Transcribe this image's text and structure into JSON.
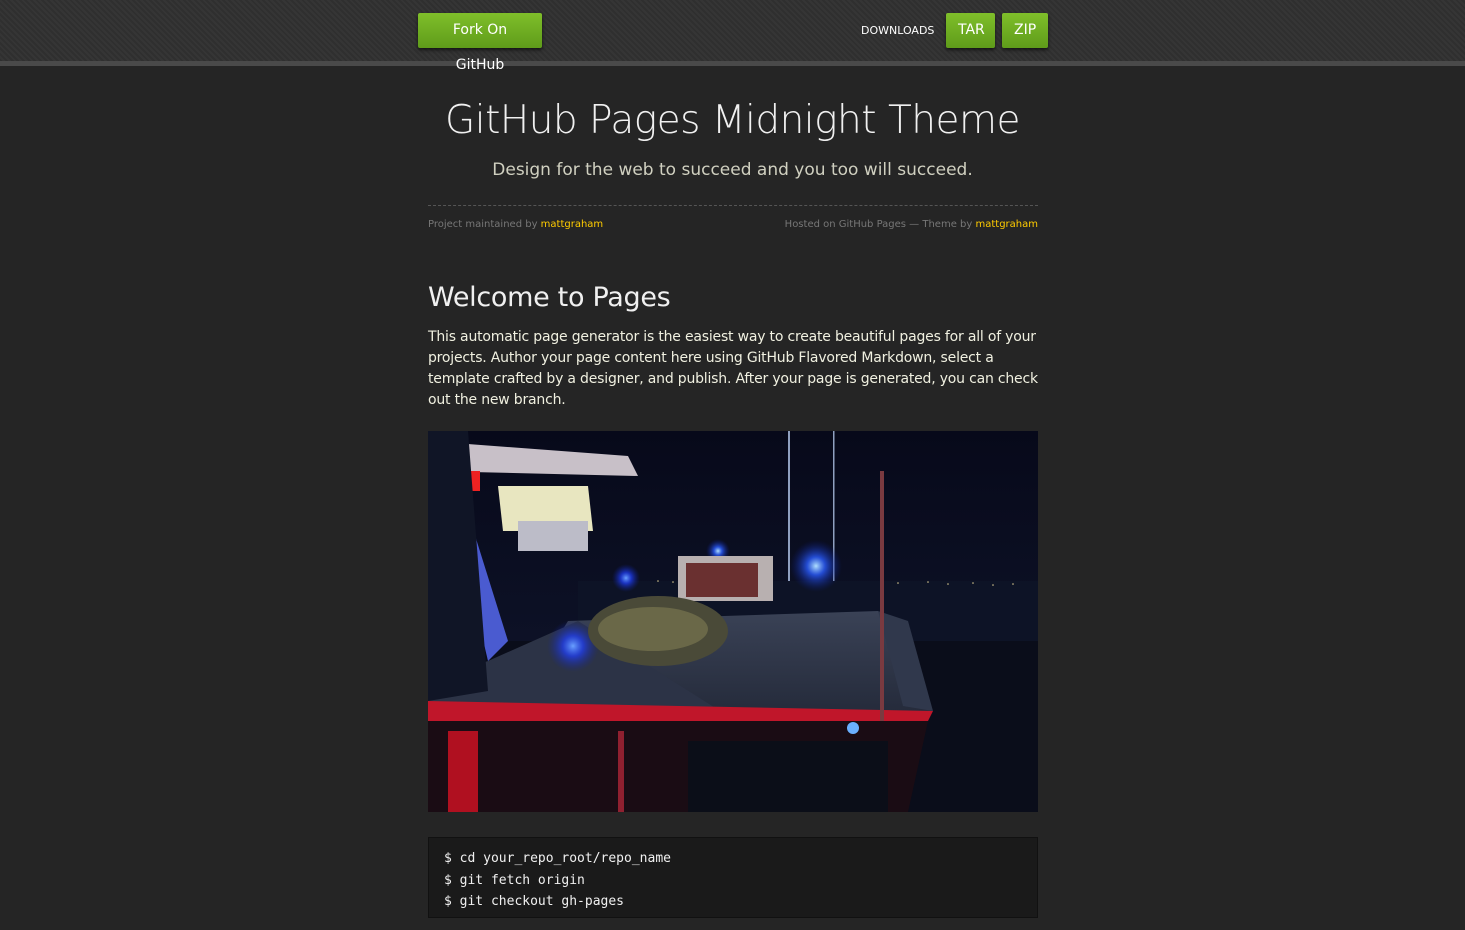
{
  "topbar": {
    "fork_label": "Fork On GitHub",
    "downloads_label": "DOWNLOADS",
    "tar_label": "TAR",
    "zip_label": "ZIP"
  },
  "header": {
    "title": "GitHub Pages Midnight Theme",
    "subtitle": "Design for the web to succeed and you too will succeed."
  },
  "credits": {
    "left_prefix": "Project maintained by ",
    "left_user": "mattgraham",
    "right_prefix": "Hosted on GitHub Pages — Theme by ",
    "right_user": "mattgraham"
  },
  "content": {
    "heading": "Welcome to Pages",
    "paragraph": "This automatic page generator is the easiest way to create beautiful pages for all of your projects. Author your page content here using GitHub Flavored Markdown, select a template crafted by a designer, and publish. After your page is generated, you can check out the new branch.",
    "code_lines": [
      "$ cd your_repo_root/repo_name",
      "$ git fetch origin",
      "$ git checkout gh-pages"
    ]
  },
  "colors": {
    "accent_green": "#6fae22",
    "link_yellow": "#ffcc00",
    "background": "#252525"
  }
}
